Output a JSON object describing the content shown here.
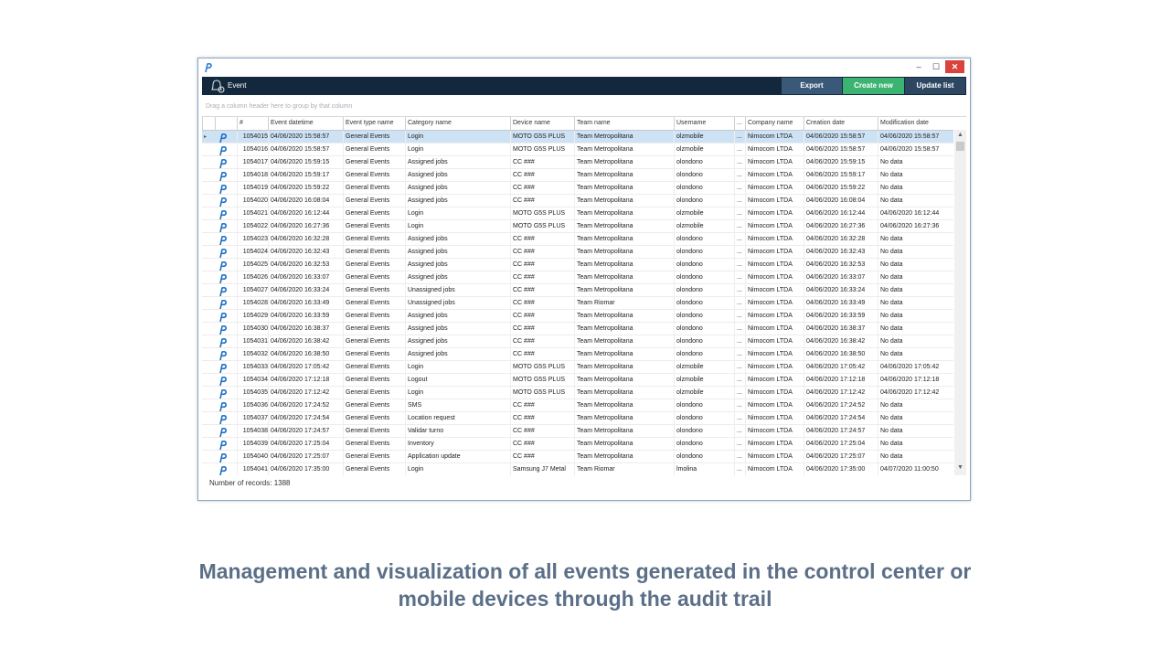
{
  "window": {
    "minimize": "–",
    "maximize": "☐",
    "close": "✕"
  },
  "toolbar": {
    "title": "Event",
    "export_label": "Export",
    "create_label": "Create new",
    "update_label": "Update list"
  },
  "group_panel": {
    "text": "Drag a column header here to group by that column"
  },
  "columns": [
    "#",
    "Event datetime",
    "Event type name",
    "Category name",
    "Device name",
    "Team name",
    "Username",
    "...",
    "Company name",
    "Creation date",
    "Modification date"
  ],
  "rows": [
    [
      "1054015",
      "04/06/2020 15:58:57",
      "General Events",
      "Login",
      "MOTO G5S PLUS",
      "Team Metropolitana",
      "olzmobile",
      "...",
      "Nimocom LTDA",
      "04/06/2020 15:58:57",
      "04/06/2020 15:58:57"
    ],
    [
      "1054016",
      "04/06/2020 15:58:57",
      "General Events",
      "Login",
      "MOTO G5S PLUS",
      "Team Metropolitana",
      "olzmobile",
      "...",
      "Nimocom LTDA",
      "04/06/2020 15:58:57",
      "04/06/2020 15:58:57"
    ],
    [
      "1054017",
      "04/06/2020 15:59:15",
      "General Events",
      "Assigned jobs",
      "CC ###",
      "Team Metropolitana",
      "olondono",
      "...",
      "Nimocom LTDA",
      "04/06/2020 15:59:15",
      "No data"
    ],
    [
      "1054018",
      "04/06/2020 15:59:17",
      "General Events",
      "Assigned jobs",
      "CC ###",
      "Team Metropolitana",
      "olondono",
      "...",
      "Nimocom LTDA",
      "04/06/2020 15:59:17",
      "No data"
    ],
    [
      "1054019",
      "04/06/2020 15:59:22",
      "General Events",
      "Assigned jobs",
      "CC ###",
      "Team Metropolitana",
      "olondono",
      "...",
      "Nimocom LTDA",
      "04/06/2020 15:59:22",
      "No data"
    ],
    [
      "1054020",
      "04/06/2020 16:08:04",
      "General Events",
      "Assigned jobs",
      "CC ###",
      "Team Metropolitana",
      "olondono",
      "...",
      "Nimocom LTDA",
      "04/06/2020 16:08:04",
      "No data"
    ],
    [
      "1054021",
      "04/06/2020 16:12:44",
      "General Events",
      "Login",
      "MOTO G5S PLUS",
      "Team Metropolitana",
      "olzmobile",
      "...",
      "Nimocom LTDA",
      "04/06/2020 16:12:44",
      "04/06/2020 16:12:44"
    ],
    [
      "1054022",
      "04/06/2020 16:27:36",
      "General Events",
      "Login",
      "MOTO G5S PLUS",
      "Team Metropolitana",
      "olzmobile",
      "...",
      "Nimocom LTDA",
      "04/06/2020 16:27:36",
      "04/06/2020 16:27:36"
    ],
    [
      "1054023",
      "04/06/2020 16:32:28",
      "General Events",
      "Assigned jobs",
      "CC ###",
      "Team Metropolitana",
      "olondono",
      "...",
      "Nimocom LTDA",
      "04/06/2020 16:32:28",
      "No data"
    ],
    [
      "1054024",
      "04/06/2020 16:32:43",
      "General Events",
      "Assigned jobs",
      "CC ###",
      "Team Metropolitana",
      "olondono",
      "...",
      "Nimocom LTDA",
      "04/06/2020 16:32:43",
      "No data"
    ],
    [
      "1054025",
      "04/06/2020 16:32:53",
      "General Events",
      "Assigned jobs",
      "CC ###",
      "Team Metropolitana",
      "olondono",
      "...",
      "Nimocom LTDA",
      "04/06/2020 16:32:53",
      "No data"
    ],
    [
      "1054026",
      "04/06/2020 16:33:07",
      "General Events",
      "Assigned jobs",
      "CC ###",
      "Team Metropolitana",
      "olondono",
      "...",
      "Nimocom LTDA",
      "04/06/2020 16:33:07",
      "No data"
    ],
    [
      "1054027",
      "04/06/2020 16:33:24",
      "General Events",
      "Unassigned jobs",
      "CC ###",
      "Team Metropolitana",
      "olondono",
      "...",
      "Nimocom LTDA",
      "04/06/2020 16:33:24",
      "No data"
    ],
    [
      "1054028",
      "04/06/2020 16:33:49",
      "General Events",
      "Unassigned jobs",
      "CC ###",
      "Team Riomar",
      "olondono",
      "...",
      "Nimocom LTDA",
      "04/06/2020 16:33:49",
      "No data"
    ],
    [
      "1054029",
      "04/06/2020 16:33:59",
      "General Events",
      "Assigned jobs",
      "CC ###",
      "Team Metropolitana",
      "olondono",
      "...",
      "Nimocom LTDA",
      "04/06/2020 16:33:59",
      "No data"
    ],
    [
      "1054030",
      "04/06/2020 16:38:37",
      "General Events",
      "Assigned jobs",
      "CC ###",
      "Team Metropolitana",
      "olondono",
      "...",
      "Nimocom LTDA",
      "04/06/2020 16:38:37",
      "No data"
    ],
    [
      "1054031",
      "04/06/2020 16:38:42",
      "General Events",
      "Assigned jobs",
      "CC ###",
      "Team Metropolitana",
      "olondono",
      "...",
      "Nimocom LTDA",
      "04/06/2020 16:38:42",
      "No data"
    ],
    [
      "1054032",
      "04/06/2020 16:38:50",
      "General Events",
      "Assigned jobs",
      "CC ###",
      "Team Metropolitana",
      "olondono",
      "...",
      "Nimocom LTDA",
      "04/06/2020 16:38:50",
      "No data"
    ],
    [
      "1054033",
      "04/06/2020 17:05:42",
      "General Events",
      "Login",
      "MOTO G5S PLUS",
      "Team Metropolitana",
      "olzmobile",
      "...",
      "Nimocom LTDA",
      "04/06/2020 17:05:42",
      "04/06/2020 17:05:42"
    ],
    [
      "1054034",
      "04/06/2020 17:12:18",
      "General Events",
      "Logout",
      "MOTO G5S PLUS",
      "Team Metropolitana",
      "olzmobile",
      "...",
      "Nimocom LTDA",
      "04/06/2020 17:12:18",
      "04/06/2020 17:12:18"
    ],
    [
      "1054035",
      "04/06/2020 17:12:42",
      "General Events",
      "Login",
      "MOTO G5S PLUS",
      "Team Metropolitana",
      "olzmobile",
      "...",
      "Nimocom LTDA",
      "04/06/2020 17:12:42",
      "04/06/2020 17:12:42"
    ],
    [
      "1054036",
      "04/06/2020 17:24:52",
      "General Events",
      "SMS",
      "CC ###",
      "Team Metropolitana",
      "olondono",
      "...",
      "Nimocom LTDA",
      "04/06/2020 17:24:52",
      "No data"
    ],
    [
      "1054037",
      "04/06/2020 17:24:54",
      "General Events",
      "Location request",
      "CC ###",
      "Team Metropolitana",
      "olondono",
      "...",
      "Nimocom LTDA",
      "04/06/2020 17:24:54",
      "No data"
    ],
    [
      "1054038",
      "04/06/2020 17:24:57",
      "General Events",
      "Validar turno",
      "CC ###",
      "Team Metropolitana",
      "olondono",
      "...",
      "Nimocom LTDA",
      "04/06/2020 17:24:57",
      "No data"
    ],
    [
      "1054039",
      "04/06/2020 17:25:04",
      "General Events",
      "Inventory",
      "CC ###",
      "Team Metropolitana",
      "olondono",
      "...",
      "Nimocom LTDA",
      "04/06/2020 17:25:04",
      "No data"
    ],
    [
      "1054040",
      "04/06/2020 17:25:07",
      "General Events",
      "Application update",
      "CC ###",
      "Team Metropolitana",
      "olondono",
      "...",
      "Nimocom LTDA",
      "04/06/2020 17:25:07",
      "No data"
    ],
    [
      "1054041",
      "04/06/2020 17:35:00",
      "General Events",
      "Login",
      "Samsung J7 Metal",
      "Team Riomar",
      "lmolina",
      "...",
      "Nimocom LTDA",
      "04/06/2020 17:35:00",
      "04/07/2020 11:00:50"
    ]
  ],
  "selected_row_index": 0,
  "footer": {
    "records_text": "Number of records: 1388"
  },
  "caption": {
    "line1": "Management and visualization of all events generated in the control center or",
    "line2": "mobile devices through the audit trail"
  },
  "colors": {
    "toolbar_bg": "#13283d",
    "create_button": "#3cb371",
    "close_button": "#d9433b",
    "selected_row": "#cde2f5",
    "caption": "#5b7088"
  },
  "icons": {
    "app": "app-logo-icon",
    "title": "bell-icon",
    "row": "pin-marker-icon"
  }
}
